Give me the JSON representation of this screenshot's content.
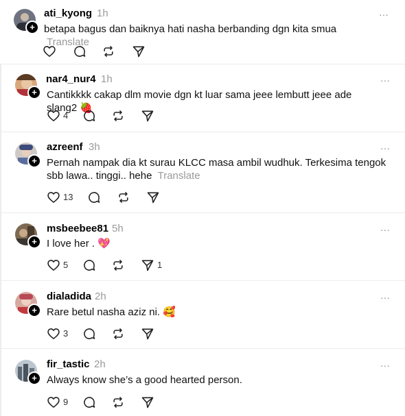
{
  "posts": [
    {
      "username": "ati_kyong",
      "time": "1h",
      "text": "betapa bagus dan baiknya hati nasha berbanding dgn kita smua",
      "translate": "Translate",
      "likes": "",
      "reposts": ""
    },
    {
      "username": "nar4_nur4",
      "time": "1h",
      "text": "Cantikkkk cakap dlm movie dgn kt luar sama jeee lembutt jeee ade slang2",
      "emoji": "🍓",
      "translate": "",
      "likes": "4",
      "reposts": ""
    },
    {
      "username": "azreenf",
      "time": "3h",
      "text": "Pernah nampak dia kt surau KLCC masa ambil wudhuk. Terkesima tengok sbb lawa.. tinggi.. hehe",
      "translate": "Translate",
      "likes": "13",
      "reposts": ""
    },
    {
      "username": "msbeebee81",
      "time": "5h",
      "text": "I love her .",
      "emoji": "💖",
      "translate": "",
      "likes": "5",
      "reposts": "1"
    },
    {
      "username": "dialadida",
      "time": "2h",
      "text": "Rare betul nasha aziz ni.",
      "emoji": "🥰",
      "translate": "",
      "likes": "3",
      "reposts": ""
    },
    {
      "username": "fir_tastic",
      "time": "2h",
      "text": "Always know she’s a good hearted person.",
      "translate": "",
      "likes": "9",
      "reposts": ""
    }
  ],
  "more_glyph": "···",
  "icons": {
    "like": "heart-icon",
    "comment": "comment-icon",
    "repost": "repost-icon",
    "share": "send-icon",
    "follow": "plus-icon"
  },
  "colors": {
    "text": "#111111",
    "muted": "#9a9a9a",
    "divider": "#ececec",
    "icon": "#222222"
  }
}
